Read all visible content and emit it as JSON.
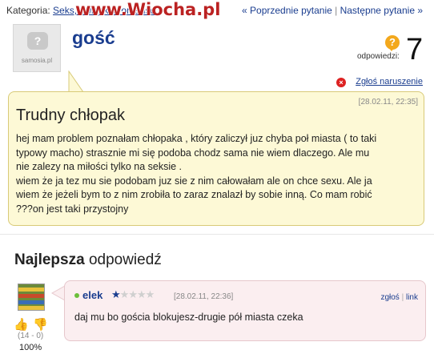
{
  "header": {
    "category_label": "Kategoria:",
    "category_link": "Seks, związki i romanse",
    "watermark": "www.Wiocha.pl",
    "prev_link": "« Poprzednie pytanie",
    "separator": "|",
    "next_link": "Następne pytanie »"
  },
  "asker": {
    "name": "gość",
    "avatar_brand": "samosia.pl",
    "avatar_glyph": "?"
  },
  "answers_info": {
    "label": "odpowiedzi:",
    "count": "7",
    "icon_glyph": "?"
  },
  "report": {
    "label": "Zgłoś naruszenie",
    "icon_glyph": "×"
  },
  "question": {
    "title": "Trudny chłopak",
    "date": "[28.02.11, 22:35]",
    "body_lines": [
      "hej mam problem poznałam chłopaka , który zaliczył juz chyba poł miasta ( to taki",
      "typowy macho) strasznie mi się podoba chodz sama nie wiem dlaczego. Ale mu",
      "nie zalezy na miłości tylko na seksie .",
      "wiem że ja tez mu sie podobam juz sie z nim całowałam ale on chce sexu. Ale ja",
      "wiem że jeżeli bym to z nim zrobiła to zaraz znalazł by sobie inną. Co mam robić",
      "???on jest taki przystojny"
    ]
  },
  "best_answer": {
    "heading_bold": "Najlepsza",
    "heading_rest": "odpowiedź",
    "user": "elek",
    "rating_filled": 1,
    "rating_total": 5,
    "date": "[28.02.11, 22:36]",
    "report_link": "zgłoś",
    "link_link": "link",
    "body": "daj mu bo gościa blokujesz-drugie pół miasta czeka",
    "votes": "(14 - 0)",
    "percent": "100%"
  },
  "colors": {
    "link": "#1a3d8f",
    "question_bg": "#fdf9d6",
    "answer_bg": "#fbeef0",
    "report_icon": "#d22",
    "answers_icon": "#f3a81c"
  }
}
